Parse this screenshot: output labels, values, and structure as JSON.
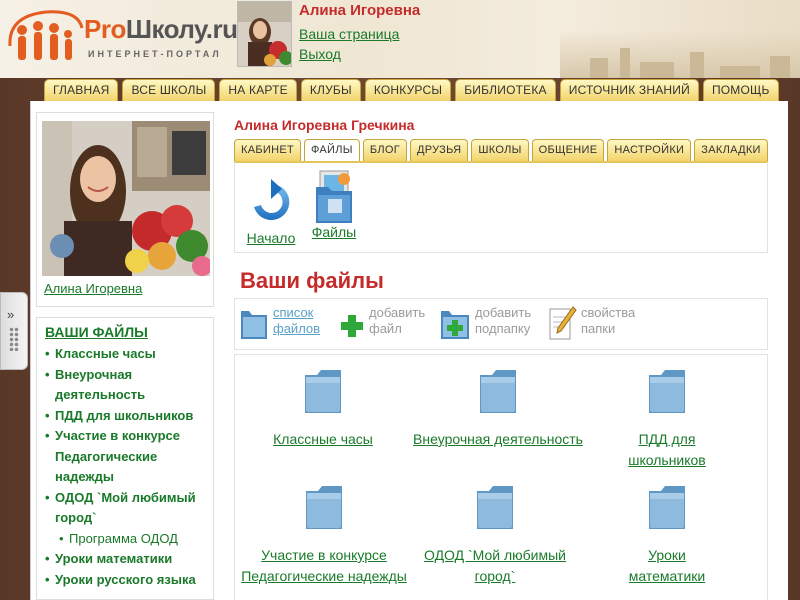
{
  "logo": {
    "pro": "Pro",
    "rest": "Школу.ru",
    "subtitle": "ИНТЕРНЕТ-ПОРТАЛ"
  },
  "user": {
    "name": "Алина Игоревна",
    "links": [
      "Ваша страница",
      "Выход"
    ]
  },
  "topnav": [
    "ГЛАВНАЯ",
    "ВСЕ ШКОЛЫ",
    "НА КАРТЕ",
    "КЛУБЫ",
    "КОНКУРСЫ",
    "БИБЛИОТЕКА",
    "ИСТОЧНИК ЗНАНИЙ",
    "ПОМОЩЬ"
  ],
  "profile": {
    "name": "Алина Игоревна"
  },
  "left_menu": {
    "title": "ВАШИ ФАЙЛЫ",
    "items": [
      {
        "label": "Классные часы",
        "sub": false
      },
      {
        "label": "Внеурочная деятельность",
        "sub": false
      },
      {
        "label": "ПДД для школьников",
        "sub": false
      },
      {
        "label": "Участие в конкурсе Педагогические надежды",
        "sub": false
      },
      {
        "label": "ОДОД `Мой любимый город`",
        "sub": false
      },
      {
        "label": "Программа ОДОД",
        "sub": true
      },
      {
        "label": "Уроки математики",
        "sub": false
      },
      {
        "label": "Уроки русского языка",
        "sub": false
      }
    ]
  },
  "page": {
    "owner": "Алина Игоревна Гречкина",
    "tabs": [
      "КАБИНЕТ",
      "ФАЙЛЫ",
      "БЛОГ",
      "ДРУЗЬЯ",
      "ШКОЛЫ",
      "ОБЩЕНИЕ",
      "НАСТРОЙКИ",
      "ЗАКЛАДКИ"
    ],
    "active_tab": "ФАЙЛЫ",
    "icons": [
      "Начало",
      "Файлы"
    ],
    "section_title": "Ваши файлы",
    "toolbar": [
      {
        "line1": "список",
        "line2": "файлов",
        "state": "active"
      },
      {
        "line1": "добавить",
        "line2": "файл",
        "state": "disabled"
      },
      {
        "line1": "добавить",
        "line2": "подпапку",
        "state": "disabled"
      },
      {
        "line1": "свойства",
        "line2": "папки",
        "state": "disabled"
      }
    ],
    "folders": [
      {
        "l1": "Классные часы",
        "l2": ""
      },
      {
        "l1": "Внеурочная деятельность",
        "l2": ""
      },
      {
        "l1": "ПДД для школьников",
        "l2": ""
      },
      {
        "l1": "Участие в конкурсе",
        "l2": "Педагогические надежды"
      },
      {
        "l1": "ОДОД `Мой любимый",
        "l2": "город`"
      },
      {
        "l1": "Уроки математики",
        "l2": ""
      }
    ]
  },
  "colors": {
    "accent_red": "#c52b2b",
    "link_green": "#1a7a2a",
    "tab_yellow": "#f2d46c",
    "frame_brown": "#6e4a34",
    "logo_orange": "#e35d21"
  }
}
